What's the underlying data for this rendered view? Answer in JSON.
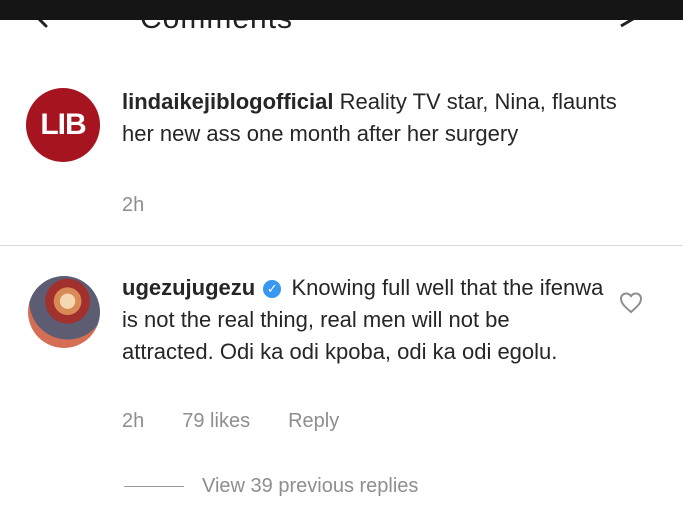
{
  "header": {
    "title_fragment": "Comments"
  },
  "caption": {
    "logo_text": "LIB",
    "username": "lindaikejiblogofficial",
    "text": "Reality TV star, Nina, flaunts her new ass one month after her surgery",
    "time": "2h"
  },
  "comment": {
    "username": "ugezujugezu",
    "verified": "✓",
    "text": "Knowing full well that the ifenwa is not the real thing, real men will not be attracted. Odi ka odi kpoba, odi ka odi egolu.",
    "time": "2h",
    "likes": "79 likes",
    "reply_label": "Reply"
  },
  "replies": {
    "view_label": "View 39 previous replies"
  },
  "icons": {
    "back": "back-arrow-icon",
    "heart": "heart-outline-icon",
    "share": "share-icon"
  }
}
